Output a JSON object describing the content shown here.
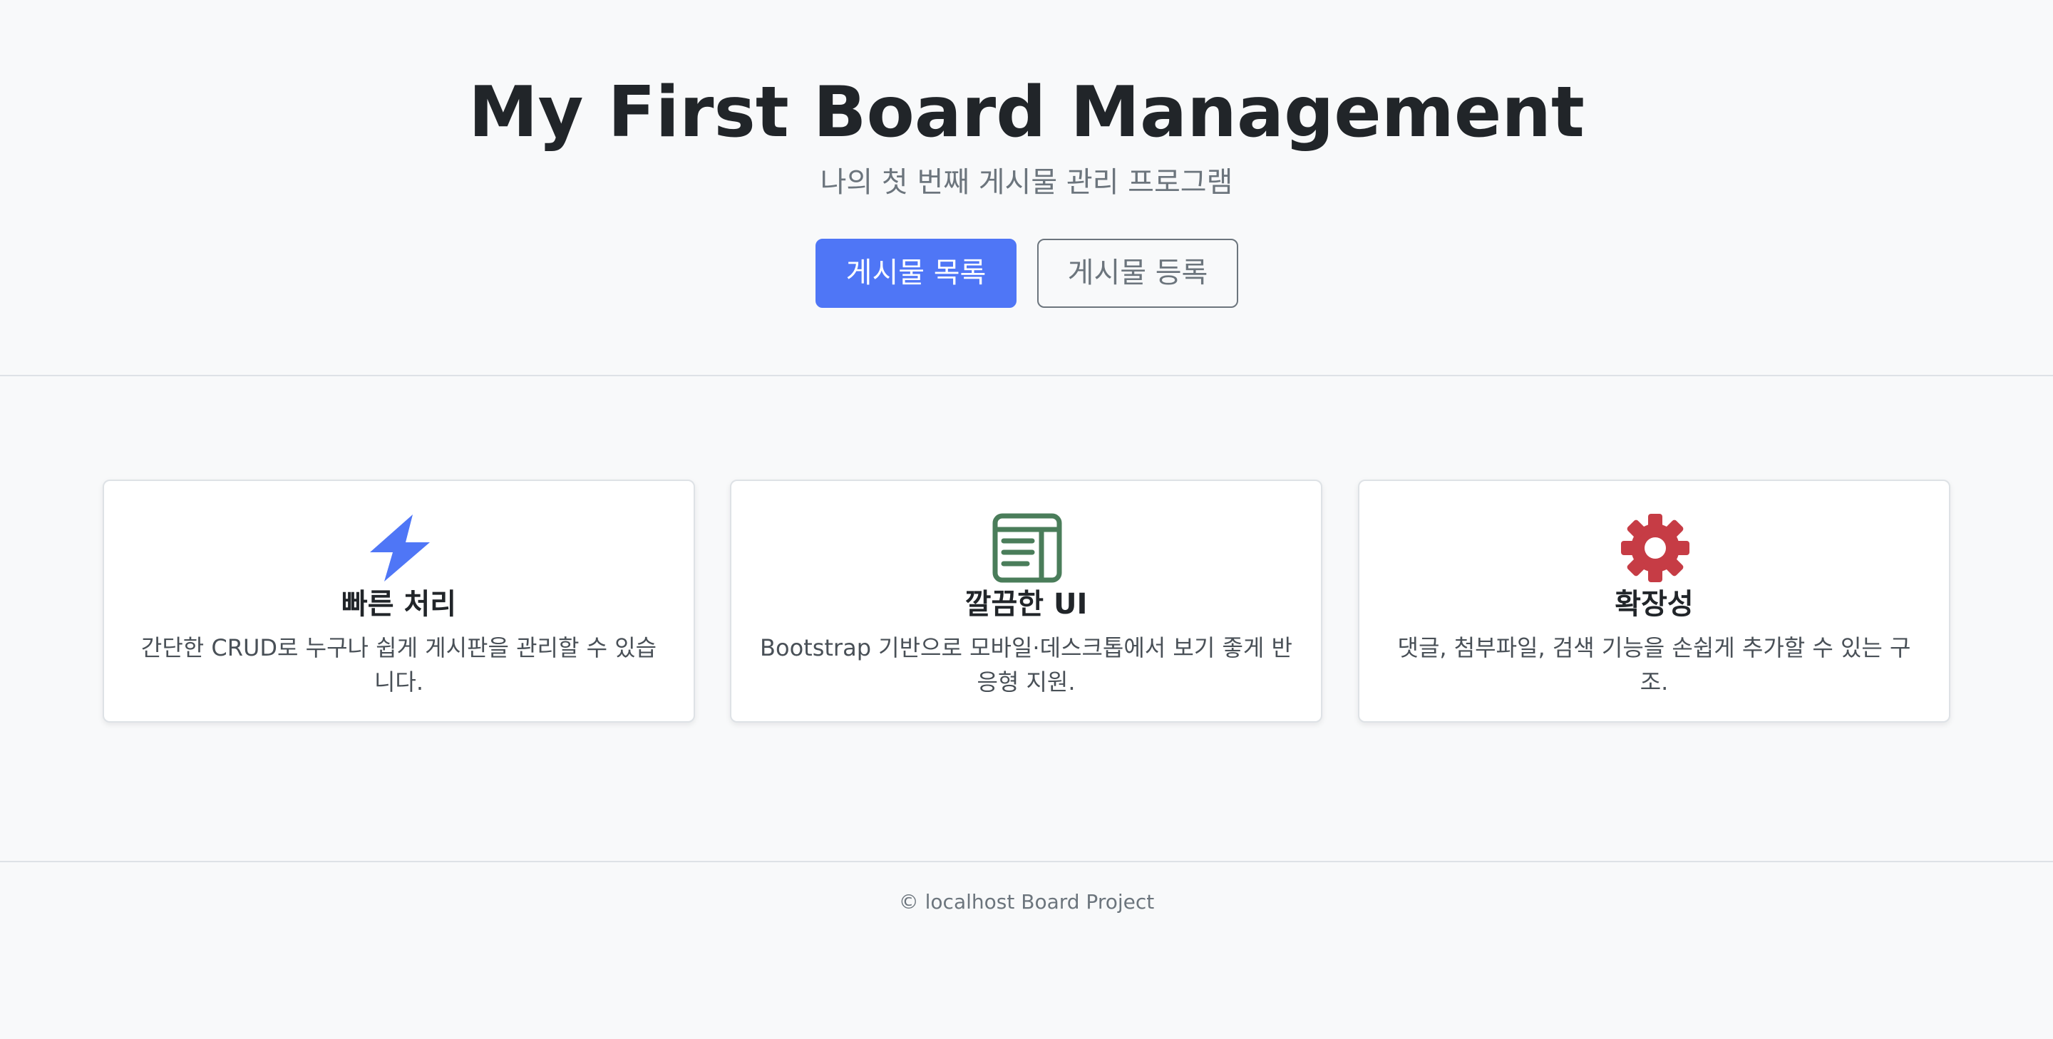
{
  "hero": {
    "title": "My First Board Management",
    "subtitle": "나의 첫 번째 게시물 관리 프로그램",
    "buttons": {
      "list_label": "게시물 목록",
      "register_label": "게시물 등록"
    }
  },
  "features": [
    {
      "icon": "lightning-icon",
      "icon_color": "#4f76f6",
      "title": "빠른 처리",
      "description": "간단한 CRUD로 누구나 쉽게 게시판을 관리할 수 있습니다."
    },
    {
      "icon": "layout-text-window-icon",
      "icon_color": "#4a7d5a",
      "title": "깔끔한 UI",
      "description": "Bootstrap 기반으로 모바일·데스크톱에서 보기 좋게 반응형 지원."
    },
    {
      "icon": "gear-icon",
      "icon_color": "#c63c45",
      "title": "확장성",
      "description": "댓글, 첨부파일, 검색 기능을 손쉽게 추가할 수 있는 구조."
    }
  ],
  "footer": {
    "text": "© localhost Board Project"
  },
  "colors": {
    "primary": "#4f76f6",
    "background": "#f8f9fa",
    "border": "#dee2e6"
  }
}
